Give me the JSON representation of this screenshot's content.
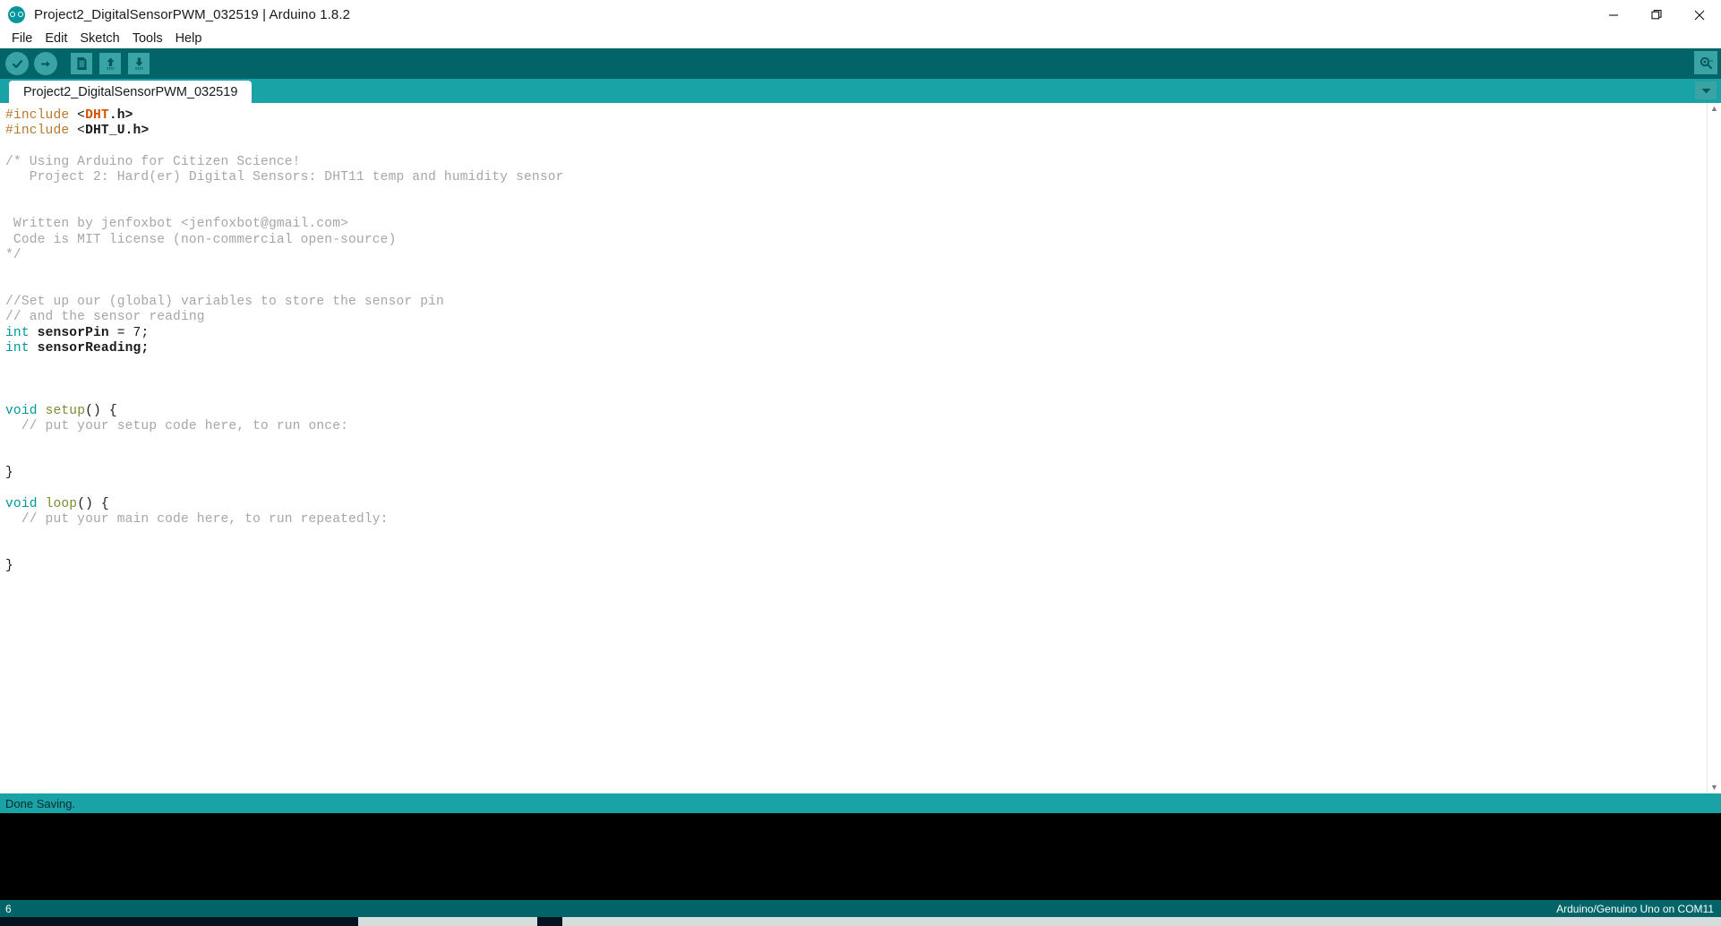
{
  "window": {
    "title": "Project2_DigitalSensorPWM_032519 | Arduino 1.8.2",
    "logo_icon": "arduino-infinity-icon",
    "minimize_icon": "minimize-icon",
    "maximize_icon": "restore-icon",
    "close_icon": "close-icon"
  },
  "menubar": {
    "items": [
      {
        "label": "File"
      },
      {
        "label": "Edit"
      },
      {
        "label": "Sketch"
      },
      {
        "label": "Tools"
      },
      {
        "label": "Help"
      }
    ]
  },
  "toolbar": {
    "buttons": [
      {
        "name": "verify-button",
        "icon": "checkmark-icon",
        "tooltip": "Verify"
      },
      {
        "name": "upload-button",
        "icon": "arrow-right-icon",
        "tooltip": "Upload"
      },
      {
        "name": "new-button",
        "icon": "new-document-icon",
        "tooltip": "New"
      },
      {
        "name": "open-button",
        "icon": "arrow-up-icon",
        "tooltip": "Open"
      },
      {
        "name": "save-button",
        "icon": "arrow-down-icon",
        "tooltip": "Save"
      }
    ],
    "serial_monitor": {
      "name": "serial-monitor-button",
      "icon": "magnifier-icon",
      "tooltip": "Serial Monitor"
    }
  },
  "tabs": {
    "active_index": 0,
    "items": [
      {
        "label": "Project2_DigitalSensorPWM_032519"
      }
    ],
    "menu_icon": "chevron-down-icon"
  },
  "editor": {
    "lines": [
      [
        {
          "t": "#include ",
          "c": "k-pre"
        },
        {
          "t": "<",
          "c": "k-op"
        },
        {
          "t": "DHT",
          "c": "k-lib"
        },
        {
          "t": ".h>",
          "c": "k-libp"
        }
      ],
      [
        {
          "t": "#include ",
          "c": "k-pre"
        },
        {
          "t": "<",
          "c": "k-op"
        },
        {
          "t": "DHT_U",
          "c": "k-libp"
        },
        {
          "t": ".h>",
          "c": "k-libp"
        }
      ],
      [],
      [
        {
          "t": "/* Using Arduino for Citizen Science!",
          "c": "k-cmt"
        }
      ],
      [
        {
          "t": "   Project 2: Hard(er) Digital Sensors: DHT11 temp and humidity sensor",
          "c": "k-cmt"
        }
      ],
      [],
      [],
      [
        {
          "t": " Written by jenfoxbot <jenfoxbot@gmail.com>",
          "c": "k-cmt"
        }
      ],
      [
        {
          "t": " Code is MIT license (non-commercial open-source)",
          "c": "k-cmt"
        }
      ],
      [
        {
          "t": "*/",
          "c": "k-cmt"
        }
      ],
      [],
      [],
      [
        {
          "t": "//Set up our (global) variables to store the sensor pin",
          "c": "k-cmt"
        }
      ],
      [
        {
          "t": "// and the sensor reading",
          "c": "k-cmt"
        }
      ],
      [
        {
          "t": "int",
          "c": "k-type"
        },
        {
          "t": " ",
          "c": "k-op"
        },
        {
          "t": "sensorPin",
          "c": "k-id"
        },
        {
          "t": " = 7;",
          "c": "k-op"
        }
      ],
      [
        {
          "t": "int",
          "c": "k-type"
        },
        {
          "t": " ",
          "c": "k-op"
        },
        {
          "t": "sensorReading;",
          "c": "k-id"
        }
      ],
      [],
      [],
      [],
      [
        {
          "t": "void",
          "c": "k-type"
        },
        {
          "t": " ",
          "c": "k-op"
        },
        {
          "t": "setup",
          "c": "k-fn"
        },
        {
          "t": "() {",
          "c": "k-op"
        }
      ],
      [
        {
          "t": "  // put your setup code here, to run once:",
          "c": "k-cmt"
        }
      ],
      [],
      [],
      [
        {
          "t": "}",
          "c": "k-op"
        }
      ],
      [],
      [
        {
          "t": "void",
          "c": "k-type"
        },
        {
          "t": " ",
          "c": "k-op"
        },
        {
          "t": "loop",
          "c": "k-fn"
        },
        {
          "t": "() {",
          "c": "k-op"
        }
      ],
      [
        {
          "t": "  // put your main code here, to run repeatedly:",
          "c": "k-cmt"
        }
      ],
      [],
      [],
      [
        {
          "t": "}",
          "c": "k-op"
        }
      ]
    ],
    "scroll_up_icon": "chevron-up-icon",
    "scroll_down_icon": "chevron-down-icon"
  },
  "console": {
    "status_message": "Done Saving.",
    "output": ""
  },
  "statusbar": {
    "line_number": "6",
    "board_info": "Arduino/Genuino Uno on COM11"
  },
  "colors": {
    "toolbar_bg": "#006468",
    "tabbar_bg": "#19a3a6",
    "accent": "#00979c",
    "console_bg": "#000000",
    "keyword": "#00979c",
    "function": "#7b8a2f",
    "comment": "#a6a6a6",
    "preprocessor": "#b77a2b",
    "library": "#d35400"
  }
}
